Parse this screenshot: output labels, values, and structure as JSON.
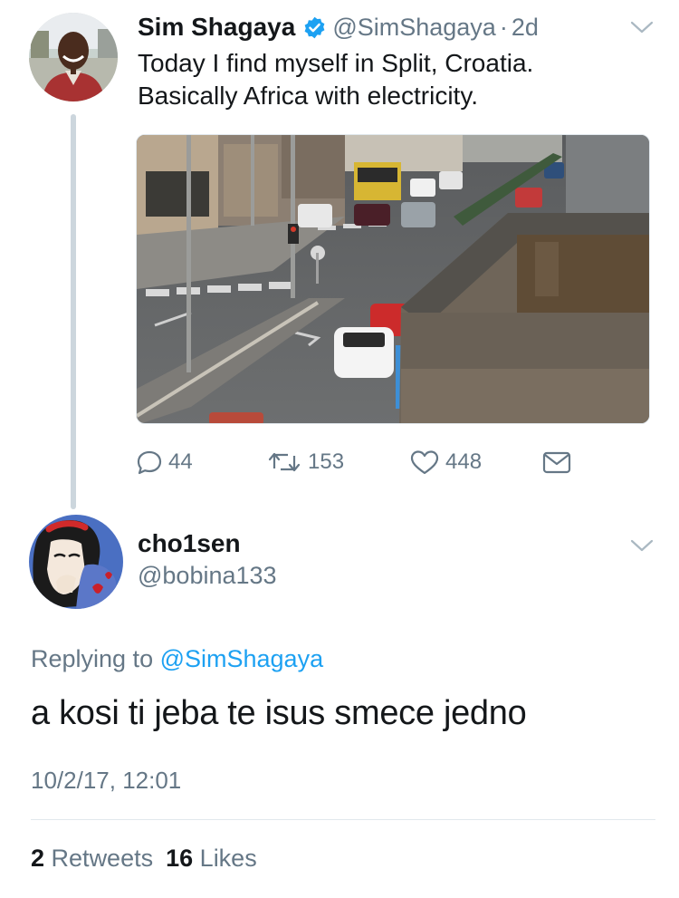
{
  "tweet": {
    "author_name": "Sim Shagaya",
    "handle": "@SimShagaya",
    "separator": "·",
    "time": "2d",
    "text_line1": "Today I find myself in Split, Croatia.",
    "text_line2": "Basically Africa with electricity.",
    "reply_count": "44",
    "retweet_count": "153",
    "like_count": "448"
  },
  "reply": {
    "author_name": "cho1sen",
    "handle": "@bobina133",
    "replying_prefix": "Replying to ",
    "replying_mention": "@SimShagaya",
    "text": "a kosi ti jeba te isus smece jedno",
    "date": "10/2/17, 12:01",
    "retweets_count": "2",
    "retweets_label": "Retweets",
    "likes_count": "16",
    "likes_label": "Likes"
  },
  "icons": {
    "verified": "verified-badge-icon",
    "chevron": "chevron-down-icon",
    "reply": "reply-icon",
    "retweet": "retweet-icon",
    "like": "heart-icon",
    "dm": "envelope-icon"
  },
  "colors": {
    "accent": "#1da1f2",
    "muted": "#657786",
    "text": "#14171a",
    "divider": "#e1e8ed"
  }
}
